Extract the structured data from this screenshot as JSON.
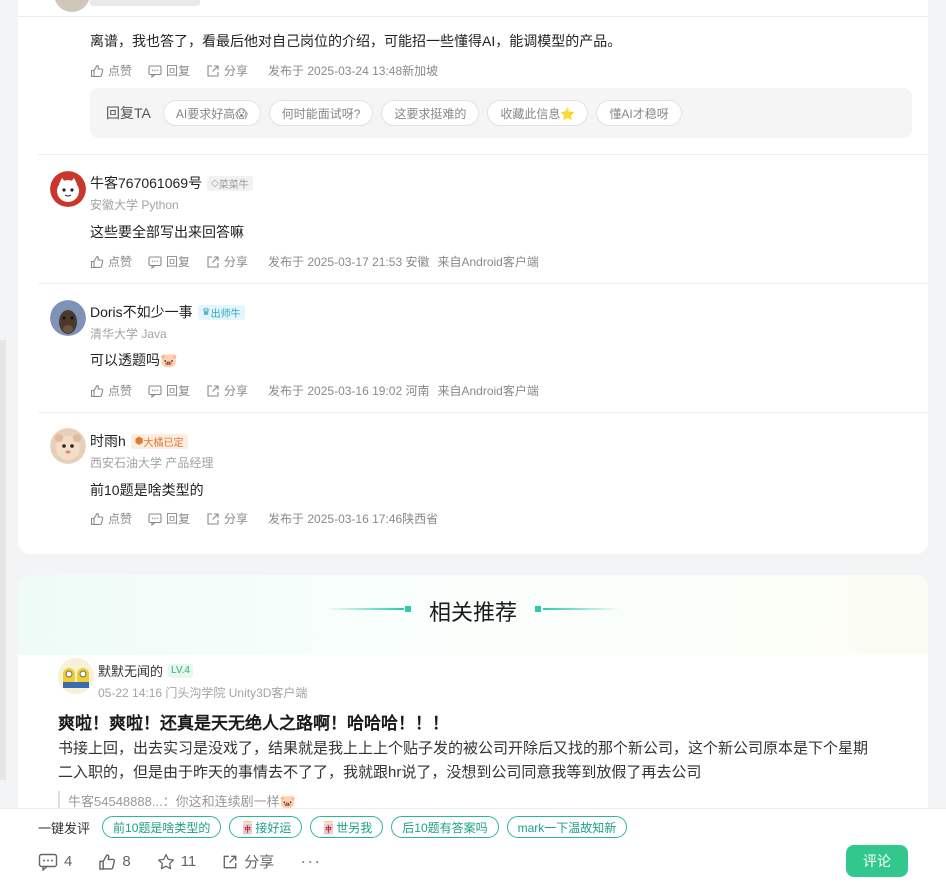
{
  "colors": {
    "accent": "#32c88d",
    "chip_teal": "#2bb6a0"
  },
  "actions": {
    "like": "点赞",
    "reply": "回复",
    "share": "分享"
  },
  "reply_comment": {
    "text": "离谱，我也答了，看最后他对自己岗位的介绍，可能招一些懂得AI，能调模型的产品。",
    "time": "发布于 2025-03-24 13:48新加坡",
    "reply_label": "回复TA",
    "chips": [
      "AI要求好高😱",
      "何时能面试呀?",
      "这要求挺难的",
      "收藏此信息⭐",
      "懂AI才稳呀"
    ]
  },
  "comments": [
    {
      "name": "牛客767061069号",
      "badge": "菜菜牛",
      "school": "安徽大学 Python",
      "text": "这些要全部写出来回答嘛",
      "time": "发布于 2025-03-17 21:53 安徽",
      "source": "来自Android客户端"
    },
    {
      "name": "Doris不如少一事",
      "badge": "出师牛",
      "school": "清华大学 Java",
      "text": "可以透题吗🐷",
      "time": "发布于 2025-03-16 19:02 河南",
      "source": "来自Android客户端"
    },
    {
      "name": "时雨h",
      "badge": "大橘已定",
      "school": "西安石油大学 产品经理",
      "text": "前10题是啥类型的",
      "time": "发布于 2025-03-16 17:46陕西省",
      "source": ""
    }
  ],
  "recommend": {
    "title": "相关推荐",
    "author": "默默无闻的",
    "level": "LV.4",
    "meta": "05-22 14:16   门头沟学院 Unity3D客户端",
    "post_title": "爽啦！爽啦！还真是天无绝人之路啊！哈哈哈！！！",
    "body": "书接上回，出去实习是没戏了，结果就是我上上上个贴子发的被公司开除后又找的那个新公司，这个新公司原本是下个星期二入职的，但是由于昨天的事情去不了了，我就跟hr说了，没想到公司同意我等到放假了再去公司",
    "quote": "牛客54548888...：你这和连续剧一样🐷"
  },
  "bottom": {
    "quick_label": "一键发评",
    "quick_chips": [
      "前10题是啥类型的",
      "🀄接好运",
      "🀄世另我",
      "后10题有答案吗",
      "mark一下温故知新"
    ],
    "comments_count": "4",
    "likes_count": "8",
    "stars_count": "11",
    "share_label": "分享",
    "more_label": "···",
    "comment_button": "评论"
  }
}
